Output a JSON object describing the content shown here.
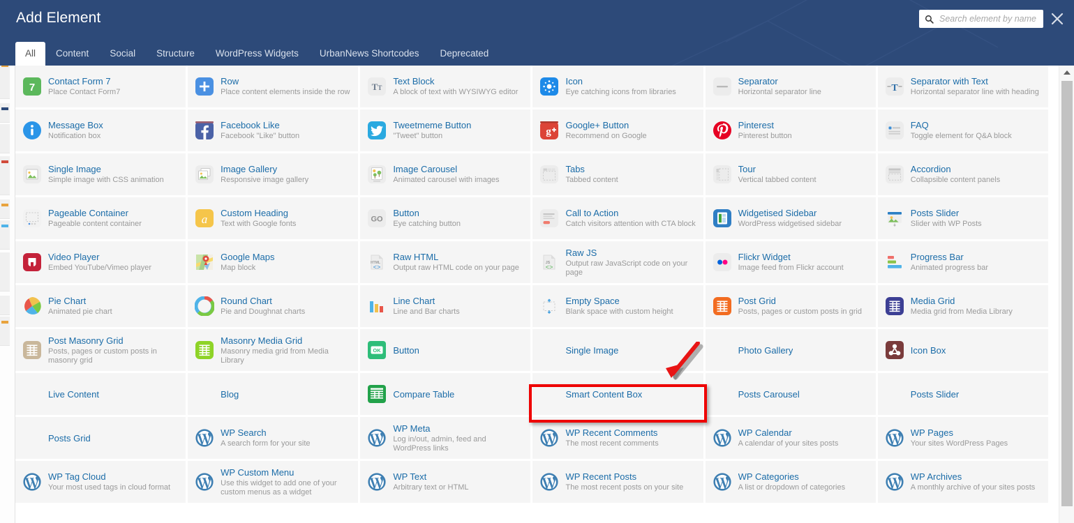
{
  "header": {
    "title": "Add Element",
    "search_placeholder": "Search element by name",
    "search_value": "",
    "search_icon": "search-icon",
    "close_icon": "close-icon",
    "bg_color": "#2d4a79"
  },
  "tabs": [
    {
      "label": "All",
      "active": true
    },
    {
      "label": "Content",
      "active": false
    },
    {
      "label": "Social",
      "active": false
    },
    {
      "label": "Structure",
      "active": false
    },
    {
      "label": "WordPress Widgets",
      "active": false
    },
    {
      "label": "UrbanNews Shortcodes",
      "active": false
    },
    {
      "label": "Deprecated",
      "active": false
    }
  ],
  "annotation": {
    "highlight_target": "Smart Content Box",
    "highlight_color": "#ee0000",
    "arrow_color": "#e81515"
  },
  "scrollbar": {
    "up_arrow_icon": "caret-up-icon",
    "thumb_color": "#c2c2c2"
  },
  "elements": [
    {
      "name": "Contact Form 7",
      "desc": "Place Contact Form7",
      "icon": "contact-form-7-icon",
      "icon_style": "cf7"
    },
    {
      "name": "Row",
      "desc": "Place content elements inside the row",
      "icon": "row-plus-icon",
      "icon_style": "row"
    },
    {
      "name": "Text Block",
      "desc": "A block of text with WYSIWYG editor",
      "icon": "text-block-icon",
      "icon_style": "textblock"
    },
    {
      "name": "Icon",
      "desc": "Eye catching icons from libraries",
      "icon": "star-icon",
      "icon_style": "iconel"
    },
    {
      "name": "Separator",
      "desc": "Horizontal separator line",
      "icon": "separator-icon",
      "icon_style": "separator"
    },
    {
      "name": "Separator with Text",
      "desc": "Horizontal separator line with heading",
      "icon": "separator-text-icon",
      "icon_style": "septext"
    },
    {
      "name": "Message Box",
      "desc": "Notification box",
      "icon": "info-icon",
      "icon_style": "msgbox"
    },
    {
      "name": "Facebook Like",
      "desc": "Facebook \"Like\" button",
      "icon": "facebook-icon",
      "icon_style": "facebook"
    },
    {
      "name": "Tweetmeme Button",
      "desc": "\"Tweet\" button",
      "icon": "twitter-icon",
      "icon_style": "twitter"
    },
    {
      "name": "Google+ Button",
      "desc": "Recommend on Google",
      "icon": "google-plus-icon",
      "icon_style": "gplus"
    },
    {
      "name": "Pinterest",
      "desc": "Pinterest button",
      "icon": "pinterest-icon",
      "icon_style": "pinterest"
    },
    {
      "name": "FAQ",
      "desc": "Toggle element for Q&A block",
      "icon": "faq-icon",
      "icon_style": "faq"
    },
    {
      "name": "Single Image",
      "desc": "Simple image with CSS animation",
      "icon": "image-icon",
      "icon_style": "image"
    },
    {
      "name": "Image Gallery",
      "desc": "Responsive image gallery",
      "icon": "gallery-icon",
      "icon_style": "gallery"
    },
    {
      "name": "Image Carousel",
      "desc": "Animated carousel with images",
      "icon": "carousel-icon",
      "icon_style": "carousel"
    },
    {
      "name": "Tabs",
      "desc": "Tabbed content",
      "icon": "tabs-icon",
      "icon_style": "tabs"
    },
    {
      "name": "Tour",
      "desc": "Vertical tabbed content",
      "icon": "tour-icon",
      "icon_style": "tour"
    },
    {
      "name": "Accordion",
      "desc": "Collapsible content panels",
      "icon": "accordion-icon",
      "icon_style": "accordion"
    },
    {
      "name": "Pageable Container",
      "desc": "Pageable content container",
      "icon": "pageable-icon",
      "icon_style": "pageable"
    },
    {
      "name": "Custom Heading",
      "desc": "Text with Google fonts",
      "icon": "custom-heading-icon",
      "icon_style": "heading"
    },
    {
      "name": "Button",
      "desc": "Eye catching button",
      "icon": "go-button-icon",
      "icon_style": "gobtn"
    },
    {
      "name": "Call to Action",
      "desc": "Catch visitors attention with CTA block",
      "icon": "cta-icon",
      "icon_style": "cta"
    },
    {
      "name": "Widgetised Sidebar",
      "desc": "WordPress widgetised sidebar",
      "icon": "sidebar-icon",
      "icon_style": "sidebar"
    },
    {
      "name": "Posts Slider",
      "desc": "Slider with WP Posts",
      "icon": "posts-slider-icon",
      "icon_style": "postsslider"
    },
    {
      "name": "Video Player",
      "desc": "Embed YouTube/Vimeo player",
      "icon": "video-icon",
      "icon_style": "video"
    },
    {
      "name": "Google Maps",
      "desc": "Map block",
      "icon": "google-maps-icon",
      "icon_style": "gmaps"
    },
    {
      "name": "Raw HTML",
      "desc": "Output raw HTML code on your page",
      "icon": "raw-html-icon",
      "icon_style": "rawhtml"
    },
    {
      "name": "Raw JS",
      "desc": "Output raw JavaScript code on your page",
      "icon": "raw-js-icon",
      "icon_style": "rawjs"
    },
    {
      "name": "Flickr Widget",
      "desc": "Image feed from Flickr account",
      "icon": "flickr-icon",
      "icon_style": "flickr"
    },
    {
      "name": "Progress Bar",
      "desc": "Animated progress bar",
      "icon": "progress-bar-icon",
      "icon_style": "progress"
    },
    {
      "name": "Pie Chart",
      "desc": "Animated pie chart",
      "icon": "pie-chart-icon",
      "icon_style": "pie"
    },
    {
      "name": "Round Chart",
      "desc": "Pie and Doughnat charts",
      "icon": "round-chart-icon",
      "icon_style": "round"
    },
    {
      "name": "Line Chart",
      "desc": "Line and Bar charts",
      "icon": "line-chart-icon",
      "icon_style": "line"
    },
    {
      "name": "Empty Space",
      "desc": "Blank space with custom height",
      "icon": "empty-space-icon",
      "icon_style": "empty"
    },
    {
      "name": "Post Grid",
      "desc": "Posts, pages or custom posts in grid",
      "icon": "post-grid-icon",
      "icon_style": "postgrid"
    },
    {
      "name": "Media Grid",
      "desc": "Media grid from Media Library",
      "icon": "media-grid-icon",
      "icon_style": "mediagrid"
    },
    {
      "name": "Post Masonry Grid",
      "desc": "Posts, pages or custom posts in masonry grid",
      "icon": "post-masonry-grid-icon",
      "icon_style": "postmasonry"
    },
    {
      "name": "Masonry Media Grid",
      "desc": "Masonry media grid from Media Library",
      "icon": "masonry-media-grid-icon",
      "icon_style": "masonrymedia"
    },
    {
      "name": "Button",
      "desc": "",
      "icon": "ok-button-icon",
      "icon_style": "okbtn"
    },
    {
      "name": "Single Image",
      "desc": "",
      "icon": "",
      "icon_style": "none"
    },
    {
      "name": "Photo Gallery",
      "desc": "",
      "icon": "",
      "icon_style": "none"
    },
    {
      "name": "Icon Box",
      "desc": "",
      "icon": "icon-box-icon",
      "icon_style": "iconbox"
    },
    {
      "name": "Live Content",
      "desc": "",
      "icon": "",
      "icon_style": "none"
    },
    {
      "name": "Blog",
      "desc": "",
      "icon": "",
      "icon_style": "none"
    },
    {
      "name": "Compare Table",
      "desc": "",
      "icon": "compare-table-icon",
      "icon_style": "compare"
    },
    {
      "name": "Smart Content Box",
      "desc": "",
      "icon": "",
      "icon_style": "none"
    },
    {
      "name": "Posts Carousel",
      "desc": "",
      "icon": "",
      "icon_style": "none"
    },
    {
      "name": "Posts Slider",
      "desc": "",
      "icon": "",
      "icon_style": "none"
    },
    {
      "name": "Posts Grid",
      "desc": "",
      "icon": "",
      "icon_style": "none"
    },
    {
      "name": "WP Search",
      "desc": "A search form for your site",
      "icon": "wordpress-icon",
      "icon_style": "wp"
    },
    {
      "name": "WP Meta",
      "desc": "Log in/out, admin, feed and WordPress links",
      "icon": "wordpress-icon",
      "icon_style": "wp"
    },
    {
      "name": "WP Recent Comments",
      "desc": "The most recent comments",
      "icon": "wordpress-icon",
      "icon_style": "wp"
    },
    {
      "name": "WP Calendar",
      "desc": "A calendar of your sites posts",
      "icon": "wordpress-icon",
      "icon_style": "wp"
    },
    {
      "name": "WP Pages",
      "desc": "Your sites WordPress Pages",
      "icon": "wordpress-icon",
      "icon_style": "wp"
    },
    {
      "name": "WP Tag Cloud",
      "desc": "Your most used tags in cloud format",
      "icon": "wordpress-icon",
      "icon_style": "wp"
    },
    {
      "name": "WP Custom Menu",
      "desc": "Use this widget to add one of your custom menus as a widget",
      "icon": "wordpress-icon",
      "icon_style": "wp"
    },
    {
      "name": "WP Text",
      "desc": "Arbitrary text or HTML",
      "icon": "wordpress-icon",
      "icon_style": "wp"
    },
    {
      "name": "WP Recent Posts",
      "desc": "The most recent posts on your site",
      "icon": "wordpress-icon",
      "icon_style": "wp"
    },
    {
      "name": "WP Categories",
      "desc": "A list or dropdown of categories",
      "icon": "wordpress-icon",
      "icon_style": "wp"
    },
    {
      "name": "WP Archives",
      "desc": "A monthly archive of your sites posts",
      "icon": "wordpress-icon",
      "icon_style": "wp"
    }
  ]
}
